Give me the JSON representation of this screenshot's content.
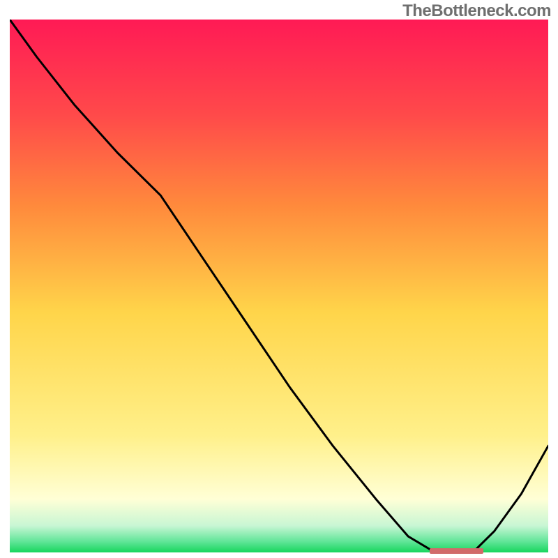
{
  "watermark": "TheBottleneck.com",
  "colors": {
    "grad_top": "#ff1a55",
    "grad_mid1": "#ff7a3c",
    "grad_mid2": "#ffd54a",
    "grad_mid3": "#fff08a",
    "grad_pale": "#ffffd6",
    "grad_green_pale": "#b6f5c7",
    "grad_green": "#17d65d",
    "curve": "#000000",
    "valley_mark": "#d16a6a"
  },
  "chart_data": {
    "type": "line",
    "title": "",
    "xlabel": "",
    "ylabel": "",
    "xlim": [
      0,
      100
    ],
    "ylim": [
      0,
      100
    ],
    "series": [
      {
        "name": "curve",
        "x": [
          0,
          5,
          12,
          20,
          28,
          36,
          44,
          52,
          60,
          68,
          74,
          79,
          83,
          86,
          90,
          95,
          100
        ],
        "y": [
          100,
          93,
          84,
          75,
          67,
          55,
          43,
          31,
          20,
          10,
          3,
          0,
          0,
          0,
          4,
          11,
          20
        ]
      }
    ],
    "valley_segment": {
      "x_start": 78,
      "x_end": 88,
      "y": 0
    },
    "note": "Values are read approximately from a chart with no visible axis ticks; scale is normalized 0–100 on both axes."
  }
}
